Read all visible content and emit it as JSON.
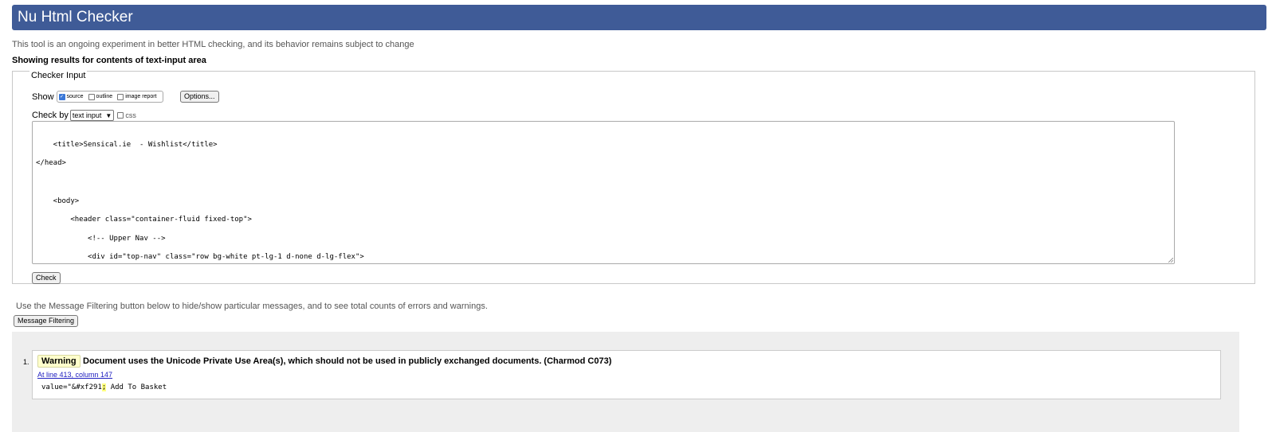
{
  "header": {
    "title": "Nu Html Checker"
  },
  "intro_text": "This tool is an ongoing experiment in better HTML checking, and its behavior remains subject to change",
  "showing_text": "Showing results for contents of text-input area",
  "checker_input": {
    "legend": "Checker Input",
    "show_label": "Show",
    "show_options": [
      {
        "label": "source",
        "checked": true
      },
      {
        "label": "outline",
        "checked": false
      },
      {
        "label": "image report",
        "checked": false
      }
    ],
    "options_button": "Options...",
    "check_by_label": "Check by",
    "check_by_value": "text input",
    "css_label": "css",
    "source_lines": [
      "    <title>Sensical.ie  - Wishlist</title>",
      "</head>",
      "",
      "",
      "    <body>",
      "        <header class=\"container-fluid fixed-top\">",
      "            <!-- Upper Nav -->",
      "            <div id=\"top-nav\" class=\"row bg-white pt-lg-1 d-none d-lg-flex\">"
    ],
    "check_button": "Check"
  },
  "filter": {
    "note": "Use the Message Filtering button below to hide/show particular messages, and to see total counts of errors and warnings.",
    "button": "Message Filtering"
  },
  "messages": [
    {
      "number": "1.",
      "type": "Warning",
      "text": "Document uses the Unicode Private Use Area(s), which should not be used in publicly exchanged documents. (Charmod C073)",
      "location": "At line 413, column 147",
      "extract_before": "value=\"&#xf291",
      "extract_highlight": ";",
      "extract_after": " Add To Basket"
    }
  ],
  "colors": {
    "header_bg": "#3f5b97",
    "warning_badge": "#ffffcc",
    "results_bg": "#eeeeee"
  }
}
